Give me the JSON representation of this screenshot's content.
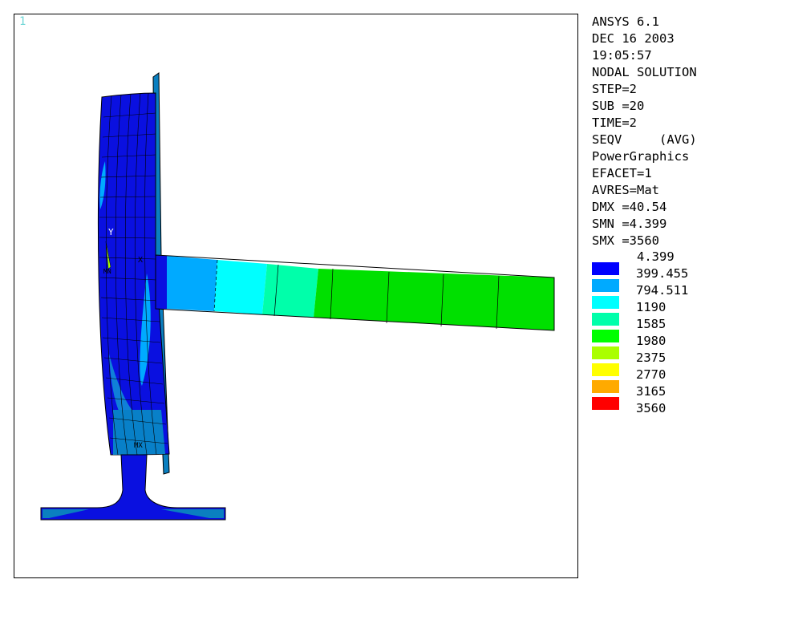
{
  "window_number": "1",
  "info_lines": [
    "ANSYS 6.1",
    "DEC 16 2003",
    "19:05:57",
    "NODAL SOLUTION",
    "STEP=2",
    "SUB =20",
    "TIME=2",
    "SEQV     (AVG)",
    "PowerGraphics",
    "EFACET=1",
    "AVRES=Mat",
    "DMX =40.54",
    "SMN =4.399",
    "SMX =3560"
  ],
  "legend": {
    "min_label": "4.399",
    "entries": [
      {
        "color": "#0000ff",
        "label": "399.455"
      },
      {
        "color": "#00aaff",
        "label": "794.511"
      },
      {
        "color": "#00ffff",
        "label": "1190"
      },
      {
        "color": "#00ffaa",
        "label": "1585"
      },
      {
        "color": "#00ff00",
        "label": "1980"
      },
      {
        "color": "#aaff00",
        "label": "2375"
      },
      {
        "color": "#ffff00",
        "label": "2770"
      },
      {
        "color": "#ffaa00",
        "label": "3165"
      },
      {
        "color": "#ff0000",
        "label": "3560"
      }
    ]
  },
  "markers": {
    "axis_y": "Y",
    "axis_x": "X",
    "mx": "MX",
    "mn": "MN"
  }
}
